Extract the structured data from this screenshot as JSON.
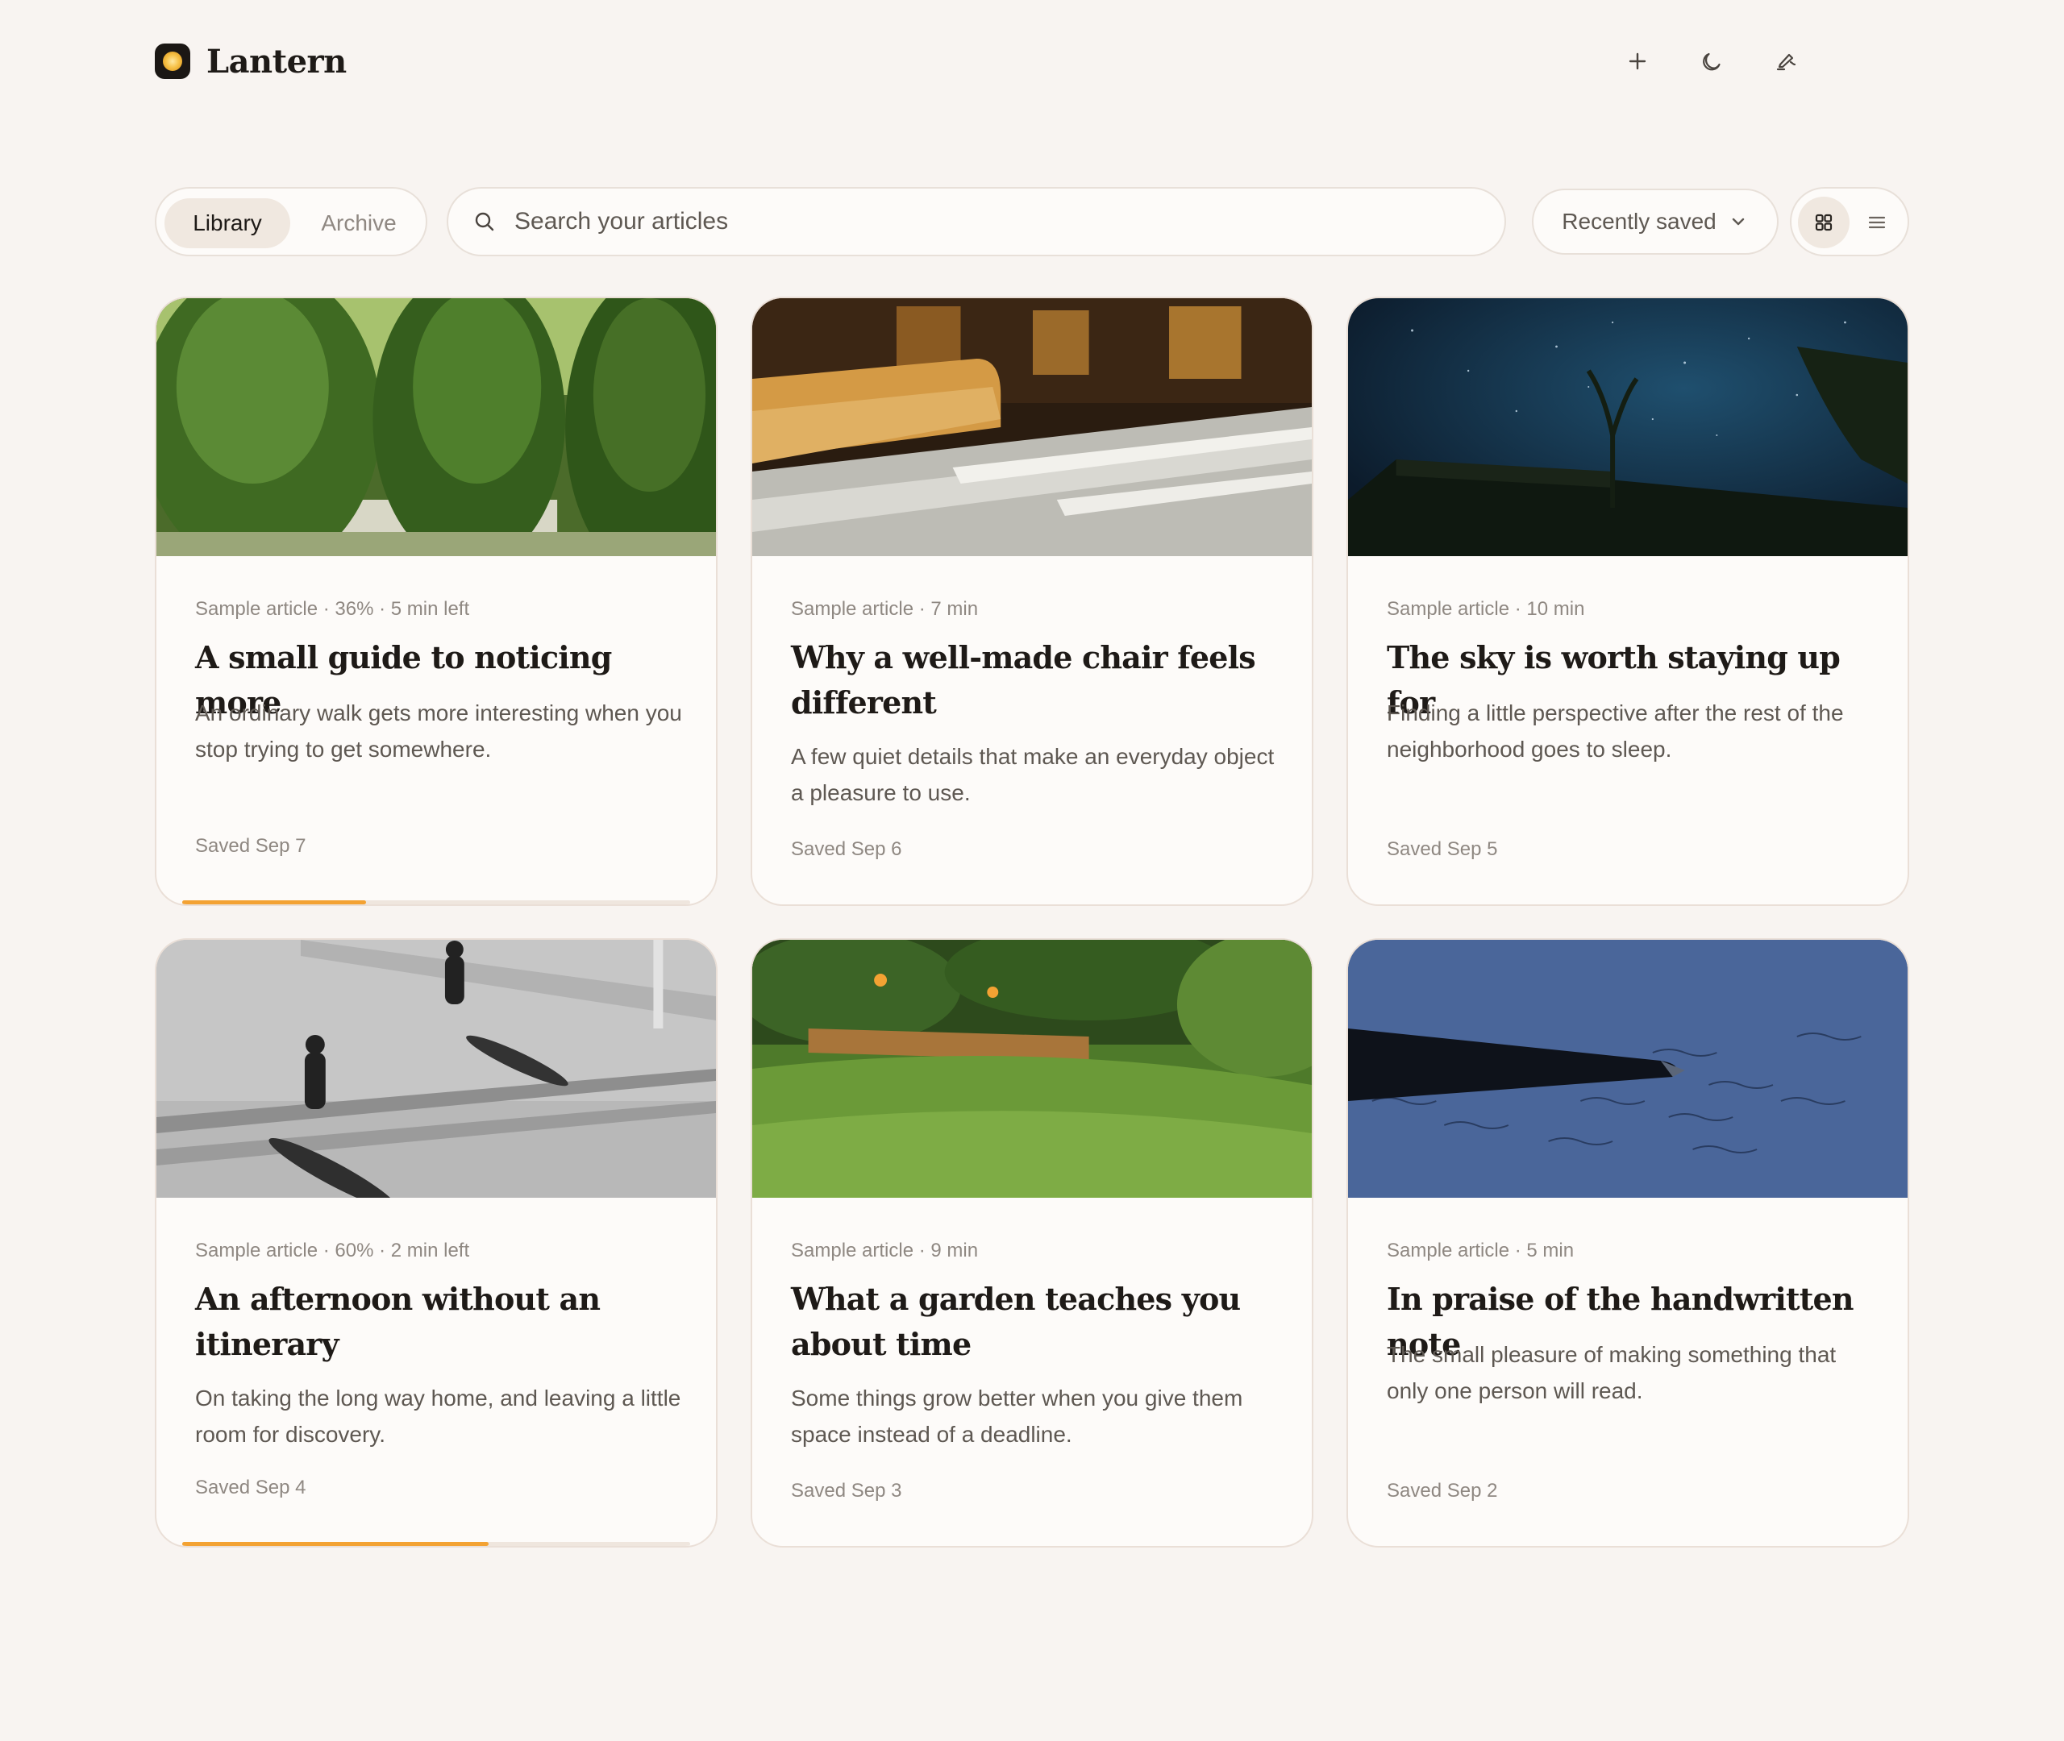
{
  "app": {
    "name": "Lantern"
  },
  "header": {
    "actions": [
      {
        "name": "add-icon"
      },
      {
        "name": "moon-icon"
      },
      {
        "name": "highlight-pen-icon"
      }
    ]
  },
  "toolbar": {
    "tabs": [
      {
        "label": "Library",
        "active": true
      },
      {
        "label": "Archive",
        "active": false
      }
    ],
    "search": {
      "placeholder": "Search your articles",
      "value": ""
    },
    "sort": {
      "selected": "Recently saved"
    },
    "view": {
      "selected": "grid"
    }
  },
  "colors": {
    "accent": "#f3a233",
    "background": "#f8f4f1",
    "card": "#fdfbf9"
  },
  "articles": [
    {
      "meta": "Sample article · 36% · 5 min left",
      "title": "A small guide to noticing more",
      "description": "An ordinary walk gets more interesting when you stop trying to get somewhere.",
      "saved": "Saved Sep 7",
      "progress": 0.36,
      "image": "hedges"
    },
    {
      "meta": "Sample article · 7 min",
      "title": "Why a well-made chair feels different",
      "description": "A few quiet details that make an everyday object a pleasure to use.",
      "saved": "Saved Sep 6",
      "progress": null,
      "image": "chair"
    },
    {
      "meta": "Sample article · 10 min",
      "title": "The sky is worth staying up for",
      "description": "Finding a little perspective after the rest of the neighborhood goes to sleep.",
      "saved": "Saved Sep 5",
      "progress": null,
      "image": "night-sky"
    },
    {
      "meta": "Sample article · 60% · 2 min left",
      "title": "An afternoon without an itinerary",
      "description": "On taking the long way home, and leaving a little room for discovery.",
      "saved": "Saved Sep 4",
      "progress": 0.6,
      "image": "pedestrians"
    },
    {
      "meta": "Sample article · 9 min",
      "title": "What a garden teaches you about time",
      "description": "Some things grow better when you give them space instead of a deadline.",
      "saved": "Saved Sep 3",
      "progress": null,
      "image": "garden"
    },
    {
      "meta": "Sample article · 5 min",
      "title": "In praise of the handwritten note",
      "description": "The small pleasure of making something that only one person will read.",
      "saved": "Saved Sep 2",
      "progress": null,
      "image": "pen-note"
    }
  ]
}
